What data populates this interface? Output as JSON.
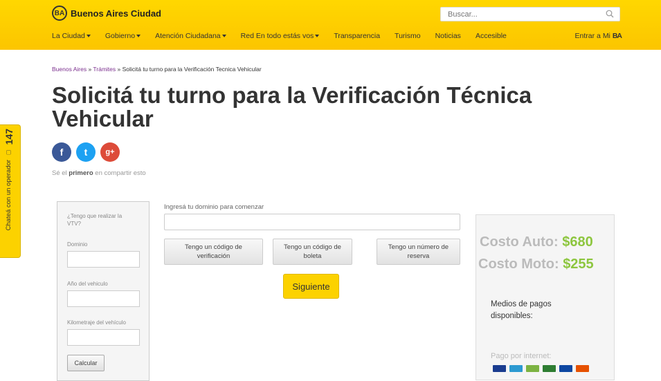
{
  "header": {
    "site_name": "Buenos Aires Ciudad",
    "logo_badge": "BA",
    "search_placeholder": "Buscar...",
    "nav": [
      "La Ciudad",
      "Gobierno",
      "Atención Ciudadana",
      "Red En todo estás vos",
      "Transparencia",
      "Turismo",
      "Noticias",
      "Accesible"
    ],
    "nav_has_caret": [
      true,
      true,
      true,
      true,
      false,
      false,
      false,
      false
    ],
    "login_prefix": "Entrar a Mi",
    "login_brand": "BA"
  },
  "breadcrumb": {
    "home": "Buenos Aires",
    "sep1": " » ",
    "section": "Trámites",
    "sep2": " » ",
    "current": "Solicitá tu turno para la Verificación Tecnica Vehicular"
  },
  "page_title": "Solicitá tu turno para la Verificación Técnica Vehicular",
  "share": {
    "prefix": "Sé el ",
    "bold": "primero",
    "suffix": " en compartir esto",
    "facebook_glyph": "f",
    "twitter_glyph": "t",
    "google_glyph": "g+"
  },
  "chat": {
    "label": "Chateá con un operador",
    "number": "147"
  },
  "left_panel": {
    "question": "¿Tengo que realizar la VTV?",
    "dominio_label": "Dominio",
    "anio_label": "Año del vehiculo",
    "km_label": "Kilometraje del vehículo",
    "calc_button": "Calcular"
  },
  "main_form": {
    "domain_label": "Ingresá tu dominio para comenzar",
    "option_verification": "Tengo un código de verificación",
    "option_boleta": "Tengo un código de boleta",
    "option_reserva": "Tengo un número de reserva",
    "next_button": "Siguiente"
  },
  "costs": {
    "auto_label": "Costo Auto: ",
    "auto_value": "$680",
    "moto_label": "Costo Moto: ",
    "moto_value": "$255",
    "medios_title": "Medios de pagos disponibles:",
    "pago_internet": "Pago por internet:"
  },
  "payment_card_colors": [
    "#1a3c8f",
    "#2d9ad1",
    "#7cb342",
    "#2e7d32",
    "#0d47a1",
    "#e65100"
  ],
  "colors": {
    "header_yellow": "#fcd200",
    "breadcrumb_link": "#7b2f8e",
    "price_green": "#8dc63f"
  }
}
